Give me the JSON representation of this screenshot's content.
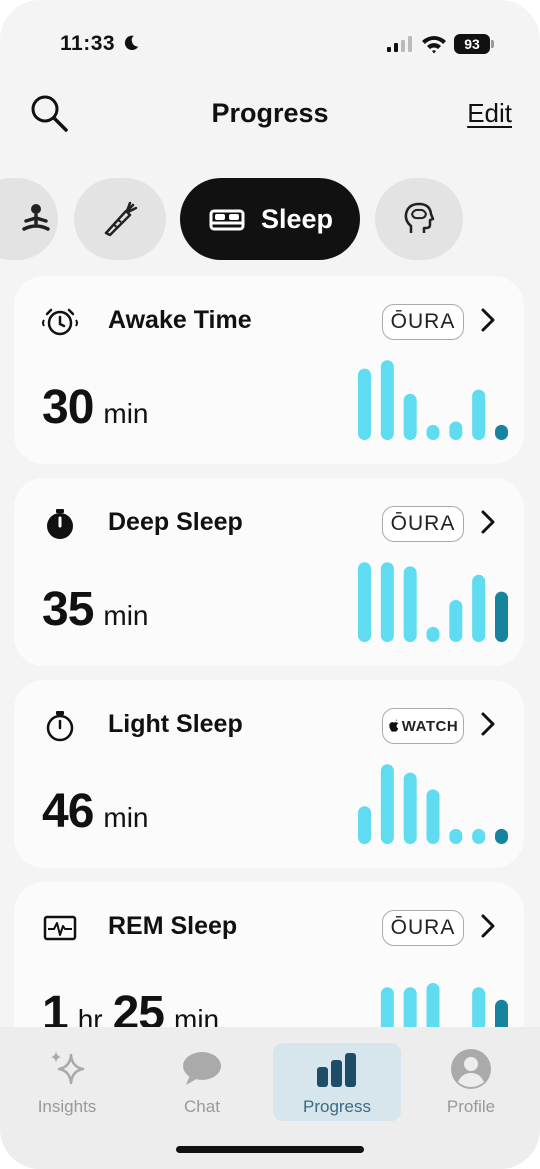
{
  "status": {
    "time": "11:33",
    "battery": "93"
  },
  "header": {
    "title": "Progress",
    "edit_label": "Edit",
    "search_icon": "search-icon"
  },
  "categories": [
    {
      "icon": "meditation-icon",
      "label": ""
    },
    {
      "icon": "carrot-icon",
      "label": ""
    },
    {
      "icon": "bed-icon",
      "label": "Sleep",
      "selected": true
    },
    {
      "icon": "brain-head-icon",
      "label": ""
    }
  ],
  "cards": [
    {
      "title": "Awake Time",
      "icon": "alarm-clock-icon",
      "source": "ŌURA",
      "value": "30",
      "unit": "min",
      "bars": [
        0.85,
        0.95,
        0.55,
        0.18,
        0.22,
        0.6,
        0.18
      ]
    },
    {
      "title": "Deep Sleep",
      "icon": "stopwatch-filled-icon",
      "source": "ŌURA",
      "value": "35",
      "unit": "min",
      "bars": [
        0.95,
        0.95,
        0.9,
        0.18,
        0.5,
        0.8,
        0.6
      ]
    },
    {
      "title": "Light Sleep",
      "icon": "stopwatch-outline-icon",
      "source": "WATCH",
      "value": "46",
      "unit": "min",
      "bars": [
        0.45,
        0.95,
        0.85,
        0.65,
        0.18,
        0.18,
        0.18
      ]
    },
    {
      "title": "REM Sleep",
      "icon": "heart-monitor-icon",
      "source": "ŌURA",
      "value_hr": "1",
      "unit_hr": "hr",
      "value": "25",
      "unit": "min",
      "bars": [
        0.18,
        0.7,
        0.7,
        0.75,
        0.18,
        0.7,
        0.55
      ]
    }
  ],
  "colors": {
    "bar_light": "#5fdcf0",
    "bar_dark": "#16849f",
    "active_tab": "#d6e6ec"
  },
  "tabs": [
    {
      "label": "Insights",
      "icon": "sparkles-icon"
    },
    {
      "label": "Chat",
      "icon": "chat-bubble-icon"
    },
    {
      "label": "Progress",
      "icon": "bar-chart-icon",
      "active": true
    },
    {
      "label": "Profile",
      "icon": "user-avatar-icon"
    }
  ]
}
